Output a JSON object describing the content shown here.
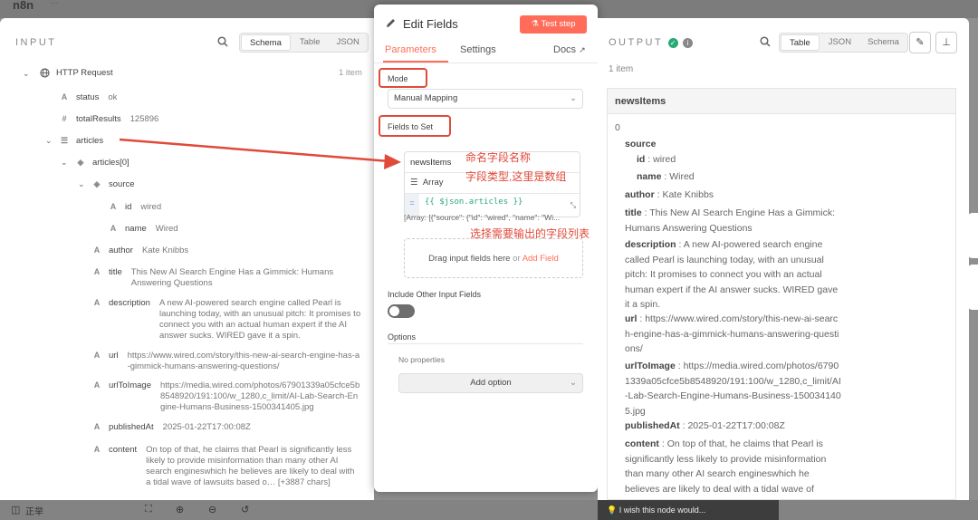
{
  "app": {
    "brand": "n8n",
    "brand_suffix": "···"
  },
  "input": {
    "title": "INPUT",
    "tabs": [
      "Schema",
      "Table",
      "JSON"
    ],
    "node": "HTTP Request",
    "count": "1 item",
    "fields": {
      "status_key": "status",
      "status_val": "ok",
      "total_key": "totalResults",
      "total_val": "125896",
      "articles_key": "articles",
      "articles0_key": "articles[0]",
      "source_key": "source",
      "id_key": "id",
      "id_val": "wired",
      "name_key": "name",
      "name_val": "Wired",
      "author_key": "author",
      "author_val": "Kate Knibbs",
      "title_key": "title",
      "title_val": "This New AI Search Engine Has a Gimmick: Humans Answering Questions",
      "desc_key": "description",
      "desc_val": "A new AI-powered search engine called Pearl is launching today, with an unusual pitch: It promises to connect you with an actual human expert if the AI answer sucks. WIRED gave it a spin.",
      "url_key": "url",
      "url_val": "https://www.wired.com/story/this-new-ai-search-engine-has-a-gimmick-humans-answering-questions/",
      "img_key": "urlToImage",
      "img_val": "https://media.wired.com/photos/67901339a05cfce5b8548920/191:100/w_1280,c_limit/AI-Lab-Search-Engine-Humans-Business-1500341405.jpg",
      "pub_key": "publishedAt",
      "pub_val": "2025-01-22T17:00:08Z",
      "content_key": "content",
      "content_val": "On top of that, he claims that Pearl is significantly less likely to provide misinformation than many other AI search engineswhich he believes are likely to deal with a tidal wave of lawsuits based o… [+3887 chars]"
    }
  },
  "editor": {
    "title": "Edit Fields",
    "test_step": "Test step",
    "tabs": {
      "parameters": "Parameters",
      "settings": "Settings",
      "docs": "Docs"
    },
    "mode_label": "Mode",
    "mode_value": "Manual Mapping",
    "fields_label": "Fields to Set",
    "field_name": "newsItems",
    "field_type": "Array",
    "field_expr": "{{ $json.articles }}",
    "field_preview": "[Array: [{\"source\": {\"id\": \"wired\", \"name\": \"Wi...",
    "drag_text": "Drag input fields here",
    "or_text": "or",
    "add_field": "Add Field",
    "include_label": "Include Other Input Fields",
    "options_label": "Options",
    "no_props": "No properties",
    "add_option": "Add option"
  },
  "annotations": {
    "a1": "命名字段名称",
    "a2": "字段类型,这里是数组",
    "a3": "选择需要输出的字段列表"
  },
  "output": {
    "title": "OUTPUT",
    "tabs": [
      "Table",
      "JSON",
      "Schema"
    ],
    "count": "1 item",
    "header": "newsItems",
    "index": "0",
    "source_key": "source",
    "id_key": "id",
    "id_val": "wired",
    "name_key": "name",
    "name_val": "Wired",
    "author_key": "author",
    "author_val": "Kate Knibbs",
    "title_key": "title",
    "title_val": "This New AI Search Engine Has a Gimmick: Humans Answering Questions",
    "desc_key": "description",
    "desc_val": "A new AI-powered search engine called Pearl is launching today, with an unusual pitch: It promises to connect you with an actual human expert if the AI answer sucks. WIRED gave it a spin.",
    "url_key": "url",
    "url_val": "https://www.wired.com/story/this-new-ai-search-engine-has-a-gimmick-humans-answering-questions/",
    "img_key": "urlToImage",
    "img_val": "https://media.wired.com/photos/67901339a05cfce5b8548920/191:100/w_1280,c_limit/AI-Lab-Search-Engine-Humans-Business-1500341405.jpg",
    "pub_key": "publishedAt",
    "pub_val": "2025-01-22T17:00:08Z",
    "content_key": "content",
    "content_val": "On top of that, he claims that Pearl is significantly less likely to provide misinformation than many other AI search engineswhich he believes are likely to deal with a tidal wave of lawsuits based o…"
  },
  "bottom": {
    "left_label": "正举",
    "wish": "I wish this node would..."
  },
  "colors": {
    "accent": "#ff6d5a",
    "annotation": "#e04a3a",
    "expr": "#2aa876"
  }
}
